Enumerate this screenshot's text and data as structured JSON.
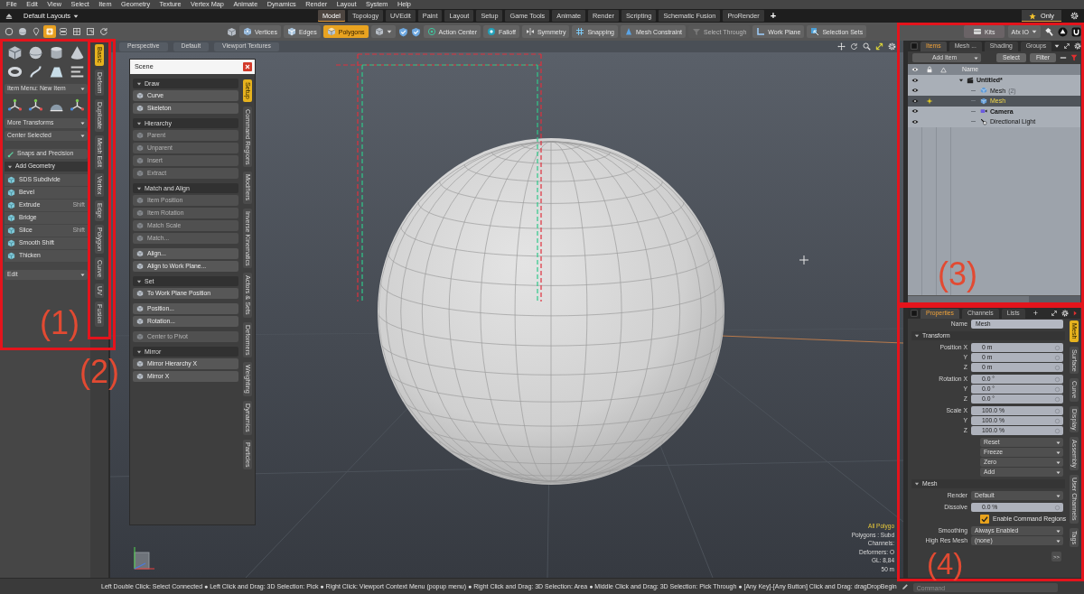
{
  "menu_bar": [
    "File",
    "Edit",
    "View",
    "Select",
    "Item",
    "Geometry",
    "Texture",
    "Vertex Map",
    "Animate",
    "Dynamics",
    "Render",
    "Layout",
    "System",
    "Help"
  ],
  "layout_bar": {
    "layouts": "Default Layouts",
    "tabs": [
      {
        "label": "Model",
        "selected": true
      },
      {
        "label": "Topology",
        "selected": false
      },
      {
        "label": "UVEdit",
        "selected": false
      },
      {
        "label": "Paint",
        "selected": false
      },
      {
        "label": "Layout",
        "selected": false
      },
      {
        "label": "Setup",
        "selected": false
      },
      {
        "label": "Game Tools",
        "selected": false
      },
      {
        "label": "Animate",
        "selected": false
      },
      {
        "label": "Render",
        "selected": false
      },
      {
        "label": "Scripting",
        "selected": false
      },
      {
        "label": "Schematic Fusion",
        "selected": false
      },
      {
        "label": "ProRender",
        "selected": false
      }
    ],
    "add_tab": "+",
    "filter": "Only"
  },
  "toolbar": {
    "mode_icons": [
      {
        "selected": false
      },
      {
        "selected": false
      },
      {
        "selected": false
      },
      {
        "selected": true
      },
      {
        "selected": false
      },
      {
        "selected": false
      },
      {
        "selected": false
      },
      {
        "selected": false
      }
    ],
    "selection_modes": [
      {
        "label": "Vertices",
        "selected": false
      },
      {
        "label": "Edges",
        "selected": false
      },
      {
        "label": "Polygons",
        "selected": true
      }
    ],
    "tools": [
      {
        "label": "Action Center",
        "disabled": false
      },
      {
        "label": "Falloff",
        "disabled": false
      },
      {
        "label": "Symmetry",
        "disabled": false
      },
      {
        "label": "Snapping",
        "disabled": false
      },
      {
        "label": "Mesh Constraint",
        "disabled": false
      },
      {
        "label": "Select Through",
        "disabled": true
      },
      {
        "label": "Work Plane",
        "disabled": false
      },
      {
        "label": "Selection Sets",
        "disabled": false
      }
    ],
    "kits": "Kits",
    "io_menu": "Afx IO"
  },
  "tool_palette": {
    "item_menu": "Item Menu: New Item",
    "dropdowns": [
      "More Transforms",
      "Center Selected"
    ],
    "snaps": "Snaps and Precision",
    "section": {
      "title": "Add Geometry",
      "expanded": true,
      "tools": [
        {
          "label": "SDS Subdivide"
        },
        {
          "label": "Bevel"
        },
        {
          "label": "Extrude",
          "shortcut": "Shift"
        },
        {
          "label": "Bridge"
        },
        {
          "label": "Slice",
          "shortcut": "Shift"
        },
        {
          "label": "Smooth Shift"
        },
        {
          "label": "Thicken"
        }
      ]
    },
    "edit": "Edit",
    "tabs": [
      {
        "label": "Basic",
        "selected": true
      },
      {
        "label": "Deform",
        "selected": false
      },
      {
        "label": "Duplicate",
        "selected": false
      },
      {
        "label": "Mesh Edit",
        "selected": false
      },
      {
        "label": "Vertex",
        "selected": false
      },
      {
        "label": "Edge",
        "selected": false
      },
      {
        "label": "Polygon",
        "selected": false
      },
      {
        "label": "Curve",
        "selected": false
      },
      {
        "label": "UV",
        "selected": false
      },
      {
        "label": "Fusion",
        "selected": false
      }
    ]
  },
  "viewport": {
    "header": [
      "Perspective",
      "Default",
      "Viewport Textures"
    ],
    "info": [
      {
        "text": "All Polygo",
        "highlight": true
      },
      {
        "text": "Polygons : Subd",
        "highlight": false
      },
      {
        "text": "Channels:",
        "highlight": false
      },
      {
        "text": "Deformers: O",
        "highlight": false
      },
      {
        "text": "GL: 8,84",
        "highlight": false
      },
      {
        "text": "50 m",
        "highlight": false
      }
    ]
  },
  "scene_panel": {
    "title": "Scene",
    "sections": [
      {
        "title": "Draw",
        "expanded": true,
        "items": [
          {
            "label": "Curve",
            "disabled": false
          },
          {
            "label": "Skeleton",
            "disabled": false
          }
        ]
      },
      {
        "title": "Hierarchy",
        "expanded": true,
        "items": [
          {
            "label": "Parent",
            "disabled": true
          },
          {
            "label": "Unparent",
            "disabled": true
          },
          {
            "label": "Insert",
            "disabled": true
          },
          {
            "label": "Extract",
            "disabled": true
          }
        ]
      },
      {
        "title": "Match and Align",
        "expanded": true,
        "items": [
          {
            "label": "Item Position",
            "disabled": true
          },
          {
            "label": "Item Rotation",
            "disabled": true
          },
          {
            "label": "Match Scale",
            "disabled": true
          },
          {
            "label": "Match...",
            "disabled": true
          }
        ]
      },
      {
        "items": [
          {
            "label": "Align...",
            "disabled": false
          },
          {
            "label": "Align to Work Plane...",
            "disabled": false
          }
        ]
      },
      {
        "title": "Set",
        "expanded": true,
        "items": [
          {
            "label": "To Work Plane Position",
            "disabled": false
          }
        ]
      },
      {
        "items": [
          {
            "label": "Position...",
            "disabled": false
          },
          {
            "label": "Rotation...",
            "disabled": false
          }
        ]
      },
      {
        "items": [
          {
            "label": "Center to Pivot",
            "disabled": true
          }
        ]
      },
      {
        "title": "Mirror",
        "expanded": true,
        "items": [
          {
            "label": "Mirror Hierarchy X",
            "disabled": false
          },
          {
            "label": "Mirror X",
            "disabled": false
          }
        ]
      }
    ],
    "tabs": [
      {
        "label": "Setup",
        "selected": true
      },
      {
        "label": "Command Regions",
        "selected": false
      },
      {
        "label": "Modifiers",
        "selected": false
      },
      {
        "label": "Inverse Kinematics",
        "selected": false
      },
      {
        "label": "Actors & Sets",
        "selected": false
      },
      {
        "label": "Deformers",
        "selected": false
      },
      {
        "label": "Weighting",
        "selected": false
      },
      {
        "label": "Dynamics",
        "selected": false
      },
      {
        "label": "Particles",
        "selected": false
      }
    ]
  },
  "items_panel": {
    "tabs": [
      {
        "label": "Items",
        "selected": true
      },
      {
        "label": "Mesh ...",
        "selected": false
      },
      {
        "label": "Shading",
        "selected": false
      },
      {
        "label": "Groups",
        "selected": false
      }
    ],
    "add_item": "Add Item",
    "buttons": [
      "Select",
      "Filter"
    ],
    "header": "Name",
    "tree": [
      {
        "name": "Untitled*",
        "kind": "scene",
        "expanded": true,
        "visible": true,
        "selected": false,
        "children": [
          {
            "name": "Mesh",
            "suffix": "(2)",
            "kind": "mesh",
            "visible": true,
            "selected": false
          },
          {
            "name": "Mesh",
            "kind": "mesh",
            "visible": true,
            "selected": true
          },
          {
            "name": "Camera",
            "kind": "camera",
            "visible": true,
            "selected": false
          },
          {
            "name": "Directional Light",
            "kind": "light",
            "visible": true,
            "selected": false
          }
        ]
      }
    ]
  },
  "properties_panel": {
    "tabs": [
      {
        "label": "Properties",
        "selected": true
      },
      {
        "label": "Channels",
        "selected": false
      },
      {
        "label": "Lists",
        "selected": false
      }
    ],
    "add_tab": "+",
    "name_label": "Name",
    "name_value": "Mesh",
    "sections": [
      {
        "title": "Transform",
        "expanded": true,
        "groups": [
          {
            "kind": "number",
            "rows": [
              {
                "label": "Position X",
                "value": "0 m"
              },
              {
                "label": "Y",
                "value": "0 m"
              },
              {
                "label": "Z",
                "value": "0 m"
              }
            ]
          },
          {
            "kind": "number",
            "rows": [
              {
                "label": "Rotation X",
                "value": "0.0 °"
              },
              {
                "label": "Y",
                "value": "0.0 °"
              },
              {
                "label": "Z",
                "value": "0.0 °"
              }
            ]
          },
          {
            "kind": "number",
            "rows": [
              {
                "label": "Scale X",
                "value": "100.0 %"
              },
              {
                "label": "Y",
                "value": "100.0 %"
              },
              {
                "label": "Z",
                "value": "100.0 %"
              }
            ]
          },
          {
            "kind": "dropdown",
            "rows": [
              {
                "value": "Reset"
              },
              {
                "value": "Freeze"
              },
              {
                "value": "Zero"
              },
              {
                "value": "Add"
              }
            ]
          }
        ]
      },
      {
        "title": "Mesh",
        "expanded": true,
        "groups": [
          {
            "kind": "dropdown",
            "rows": [
              {
                "label": "Render",
                "value": "Default"
              }
            ]
          },
          {
            "kind": "number",
            "rows": [
              {
                "label": "Dissolve",
                "value": "0.0 %"
              }
            ]
          },
          {
            "kind": "checkbox",
            "rows": [
              {
                "value": "Enable Command Regions",
                "checked": true
              }
            ]
          },
          {
            "kind": "dropdown",
            "rows": [
              {
                "label": "Smoothing",
                "value": "Always Enabled"
              },
              {
                "label": "High Res Mesh",
                "value": "(none)"
              }
            ]
          }
        ]
      }
    ],
    "more": ">>",
    "side_tabs": [
      {
        "label": "Mesh",
        "selected": true
      },
      {
        "label": "Surface",
        "selected": false
      },
      {
        "label": "Curve",
        "selected": false
      },
      {
        "label": "Display",
        "selected": false
      },
      {
        "label": "Assembly",
        "selected": false
      },
      {
        "label": "User Channels",
        "selected": false
      },
      {
        "label": "Tags",
        "selected": false
      }
    ]
  },
  "status_bar": {
    "hints": "Left Double Click: Select Connected ● Left Click and Drag: 3D Selection: Pick ● Right Click: Viewport Context Menu (popup menu) ● Right Click and Drag: 3D Selection: Area ● Middle Click and Drag: 3D Selection: Pick Through ● [Any Key]-[Any Button] Click and Drag: dragDropBegin",
    "command_placeholder": "Command"
  },
  "annotations": [
    {
      "label": "(1)"
    },
    {
      "label": "(2)"
    },
    {
      "label": "(3)"
    },
    {
      "label": "(4)"
    }
  ]
}
